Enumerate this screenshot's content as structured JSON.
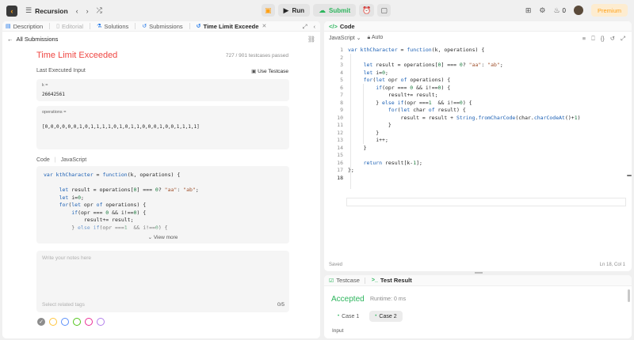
{
  "topbar": {
    "title": "Recursion",
    "run_label": "Run",
    "submit_label": "Submit",
    "notifications_count": "0",
    "premium_label": "Premium"
  },
  "left_tabs": [
    {
      "label": "Description"
    },
    {
      "label": "Editorial"
    },
    {
      "label": "Solutions"
    },
    {
      "label": "Submissions"
    },
    {
      "label": "Time Limit Exceede"
    }
  ],
  "back_label": "All Submissions",
  "result": {
    "status": "Time Limit Exceeded",
    "passed": "727 / 901  testcases passed",
    "last_input_label": "Last Executed Input",
    "use_testcase_label": "Use Testcase",
    "inputs": [
      {
        "label": "k =",
        "value": "26642561"
      },
      {
        "label": "operations =",
        "value": "[0,0,0,0,0,0,1,0,1,1,1,1,0,1,0,1,1,0,0,0,1,0,0,1,1,1,1]"
      }
    ]
  },
  "code_section": {
    "label": "Code",
    "language": "JavaScript",
    "view_more": "View more"
  },
  "notes": {
    "placeholder": "Write your notes here",
    "tags_placeholder": "Select related tags",
    "count": "0/5"
  },
  "note_colors": [
    "#8c8c8c",
    "#ffc53d",
    "#5b8ff9",
    "#52c41a",
    "#eb2f96",
    "#b37feb"
  ],
  "editor": {
    "tab_label": "Code",
    "language": "JavaScript",
    "auto_label": "Auto",
    "status": "Saved",
    "cursor": "Ln 18, Col 1",
    "line_numbers": [
      "1",
      "2",
      "3",
      "4",
      "5",
      "6",
      "7",
      "8",
      "9",
      "10",
      "11",
      "12",
      "13",
      "14",
      "15",
      "16",
      "17",
      "18"
    ]
  },
  "testcase_panel": {
    "tab_testcase": "Testcase",
    "tab_result": "Test Result",
    "status": "Accepted",
    "runtime": "Runtime: 0 ms",
    "cases": [
      "Case 1",
      "Case 2"
    ],
    "input_label": "Input"
  },
  "accent_colors": {
    "green": "#2db55d",
    "red": "#ef4743",
    "orange": "#ffa116"
  }
}
